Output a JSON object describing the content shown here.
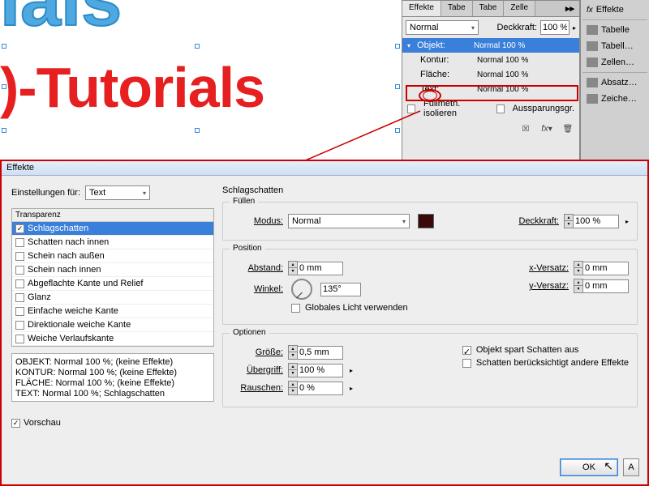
{
  "canvas": {
    "blueText": "orials",
    "redText": ")-Tutorials"
  },
  "effPanel": {
    "tabs": [
      "Effekte",
      "Tabe",
      "Tabe",
      "Zelle"
    ],
    "blendMode": "Normal",
    "opacityLabel": "Deckkraft:",
    "opacityValue": "100 %",
    "rows": [
      {
        "lbl": "Objekt:",
        "val": "Normal 100 %"
      },
      {
        "lbl": "Kontur:",
        "val": "Normal 100 %"
      },
      {
        "lbl": "Fläche:",
        "val": "Normal 100 %"
      },
      {
        "lbl": "Text:",
        "val": "Normal 100 %"
      }
    ],
    "isolate": "Füllmeth. isolieren",
    "knockout": "Aussparungsgr."
  },
  "sideButtons": [
    "Effekte",
    "Tabelle",
    "Tabell…",
    "Zellen…",
    "Absatz…",
    "Zeiche…"
  ],
  "dialog": {
    "title": "Effekte",
    "settingsFor": "Einstellungen für:",
    "settingsForValue": "Text",
    "transparency": "Transparenz",
    "fxItems": [
      "Schlagschatten",
      "Schatten nach innen",
      "Schein nach außen",
      "Schein nach innen",
      "Abgeflachte Kante und Relief",
      "Glanz",
      "Einfache weiche Kante",
      "Direktionale weiche Kante",
      "Weiche Verlaufskante"
    ],
    "summary": [
      "OBJEKT: Normal 100 %; (keine Effekte)",
      "KONTUR: Normal 100 %; (keine Effekte)",
      "FLÄCHE: Normal 100 %; (keine Effekte)",
      "TEXT: Normal 100 %; Schlagschatten"
    ],
    "preview": "Vorschau",
    "rightTitle": "Schlagschatten",
    "fill": {
      "group": "Füllen",
      "mode": "Modus:",
      "modeVal": "Normal",
      "opacity": "Deckkraft:",
      "opacityVal": "100 %"
    },
    "position": {
      "group": "Position",
      "distance": "Abstand:",
      "distanceVal": "0 mm",
      "angle": "Winkel:",
      "angleVal": "135°",
      "globalLight": "Globales Licht verwenden",
      "xoff": "x-Versatz:",
      "xoffVal": "0 mm",
      "yoff": "y-Versatz:",
      "yoffVal": "0 mm"
    },
    "options": {
      "group": "Optionen",
      "size": "Größe:",
      "sizeVal": "0,5 mm",
      "spread": "Übergriff:",
      "spreadVal": "100 %",
      "noise": "Rauschen:",
      "noiseVal": "0 %",
      "knockout": "Objekt spart Schatten aus",
      "honor": "Schatten berücksichtigt andere Effekte"
    },
    "ok": "OK",
    "cancel": "A"
  }
}
